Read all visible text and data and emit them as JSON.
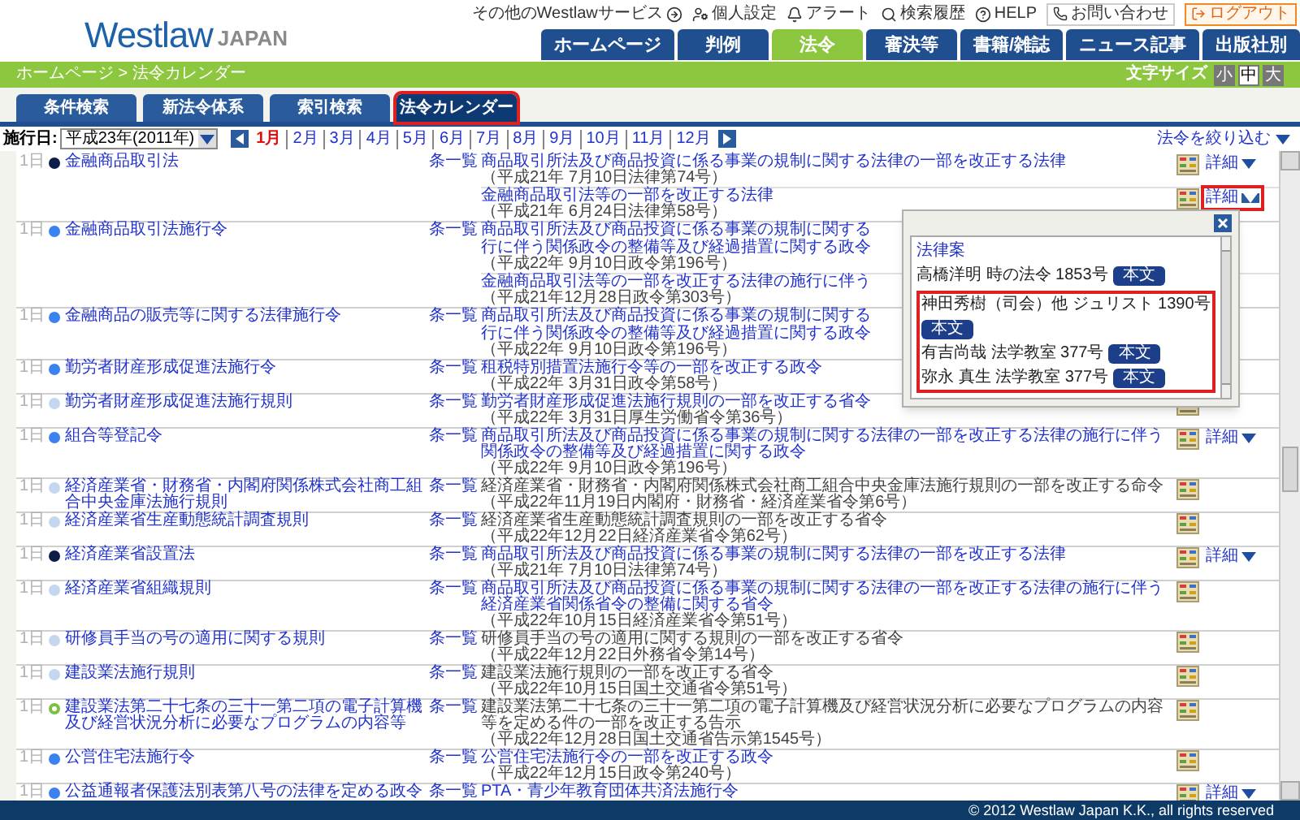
{
  "header": {
    "logo": {
      "word": "Westlaw",
      "suffix": "JAPAN"
    },
    "utility_links": [
      {
        "label": "その他のWestlawサービス",
        "kind": "services"
      },
      {
        "label": "個人設定",
        "kind": "settings"
      },
      {
        "label": "アラート",
        "kind": "alert"
      },
      {
        "label": "検索履歴",
        "kind": "history"
      },
      {
        "label": "HELP",
        "kind": "help"
      }
    ],
    "contact": "お問い合わせ",
    "logout": "ログアウト",
    "tabs": [
      {
        "label": "ホームページ",
        "selected": false
      },
      {
        "label": "判例",
        "selected": false
      },
      {
        "label": "法令",
        "selected": true
      },
      {
        "label": "審決等",
        "selected": false
      },
      {
        "label": "書籍/雑誌",
        "selected": false
      },
      {
        "label": "ニュース記事",
        "selected": false
      },
      {
        "label": "出版社別",
        "selected": false
      }
    ]
  },
  "breadcrumb": "ホームページ > 法令カレンダー",
  "font_size": {
    "label": "文字サイズ",
    "options": [
      {
        "label": "小",
        "selected": false
      },
      {
        "label": "中",
        "selected": true
      },
      {
        "label": "大",
        "selected": false
      }
    ]
  },
  "subtabs": [
    {
      "label": "条件検索",
      "selected": false
    },
    {
      "label": "新法令体系",
      "selected": false
    },
    {
      "label": "索引検索",
      "selected": false
    },
    {
      "label": "法令カレンダー",
      "selected": true
    }
  ],
  "filter_bar": {
    "date_label": "施行日:",
    "year": "平成23年(2011年)",
    "narrow": "法令を絞り込む",
    "months": [
      {
        "label": "1月",
        "selected": true
      },
      {
        "label": "2月",
        "selected": false
      },
      {
        "label": "3月",
        "selected": false
      },
      {
        "label": "4月",
        "selected": false
      },
      {
        "label": "5月",
        "selected": false
      },
      {
        "label": "6月",
        "selected": false
      },
      {
        "label": "7月",
        "selected": false
      },
      {
        "label": "8月",
        "selected": false
      },
      {
        "label": "9月",
        "selected": false
      },
      {
        "label": "10月",
        "selected": false
      },
      {
        "label": "11月",
        "selected": false
      },
      {
        "label": "12月",
        "selected": false
      }
    ]
  },
  "rows": [
    {
      "day": "1日",
      "color": "#0b1d48",
      "kind": "solid",
      "name": "金融商品取引法",
      "articles": "条一覧",
      "amendments": [
        {
          "title": [
            "商品取引所法及び商品投資に係る事業の規制に関する法律の一部を改正する法律"
          ],
          "link": true,
          "citation": "（平成21年 7月10日法律第74号）",
          "icon": true,
          "detail": "詳細",
          "detail_open": false
        },
        {
          "title": [
            "金融商品取引法等の一部を改正する法律"
          ],
          "link": true,
          "citation": "（平成21年 6月24日法律第58号）",
          "icon": true,
          "detail": "詳細",
          "detail_open": true
        }
      ]
    },
    {
      "day": "1日",
      "color": "#3b82f0",
      "kind": "solid",
      "name": "金融商品取引法施行令",
      "articles": "条一覧",
      "amendments": [
        {
          "title": [
            "商品取引所法及び商品投資に係る事業の規制に関する",
            "行に伴う関係政令の整備等及び経過措置に関する政令"
          ],
          "link": true,
          "citation": "（平成22年 9月10日政令第196号）"
        },
        {
          "title": [
            "金融商品取引法等の一部を改正する法律の施行に伴う"
          ],
          "link": true,
          "citation": "（平成21年12月28日政令第303号）"
        }
      ]
    },
    {
      "day": "1日",
      "color": "#3b82f0",
      "kind": "solid",
      "name": "金融商品の販売等に関する法律施行令",
      "articles": "条一覧",
      "amendments": [
        {
          "title": [
            "商品取引所法及び商品投資に係る事業の規制に関する",
            "行に伴う関係政令の整備等及び経過措置に関する政令"
          ],
          "link": true,
          "citation": "（平成22年 9月10日政令第196号）"
        }
      ]
    },
    {
      "day": "1日",
      "color": "#3b82f0",
      "kind": "solid",
      "name": "勤労者財産形成促進法施行令",
      "articles": "条一覧",
      "amendments": [
        {
          "title": [
            "租税特別措置法施行令等の一部を改正する政令"
          ],
          "link": true,
          "citation": "（平成22年 3月31日政令第58号）"
        }
      ]
    },
    {
      "day": "1日",
      "color": "#c5d7ef",
      "kind": "solid",
      "name": "勤労者財産形成促進法施行規則",
      "articles": "条一覧",
      "amendments": [
        {
          "title": [
            "勤労者財産形成促進法施行規則の一部を改正する省令"
          ],
          "link": true,
          "citation": "（平成22年 3月31日厚生労働省令第36号）",
          "icon": true
        }
      ]
    },
    {
      "day": "1日",
      "color": "#3b82f0",
      "kind": "solid",
      "name": "組合等登記令",
      "articles": "条一覧",
      "amendments": [
        {
          "title": [
            "商品取引所法及び商品投資に係る事業の規制に関する法律の一部を改正する法律の施行に伴う関係政令の整備等及び経過措置に関する政令"
          ],
          "link": true,
          "citation": "（平成22年 9月10日政令第196号）",
          "icon": true,
          "detail": "詳細",
          "detail_open": false
        }
      ]
    },
    {
      "day": "1日",
      "color": "#c5d7ef",
      "kind": "solid",
      "name": "経済産業省・財務省・内閣府関係株式会社商工組合中央金庫法施行規則",
      "articles": "条一覧",
      "amendments": [
        {
          "title": [
            "経済産業省・財務省・内閣府関係株式会社商工組合中央金庫法施行規則の一部を改正する命令"
          ],
          "link": false,
          "citation": "（平成22年11月19日内閣府・財務省・経済産業省令第6号）",
          "icon": true
        }
      ]
    },
    {
      "day": "1日",
      "color": "#c5d7ef",
      "kind": "solid",
      "name": "経済産業省生産動態統計調査規則",
      "articles": "条一覧",
      "amendments": [
        {
          "title": [
            "経済産業省生産動態統計調査規則の一部を改正する省令"
          ],
          "link": false,
          "citation": "（平成22年12月22日経済産業省令第62号）",
          "icon": true
        }
      ]
    },
    {
      "day": "1日",
      "color": "#0b1d48",
      "kind": "solid",
      "name": "経済産業省設置法",
      "articles": "条一覧",
      "amendments": [
        {
          "title": [
            "商品取引所法及び商品投資に係る事業の規制に関する法律の一部を改正する法律"
          ],
          "link": true,
          "citation": "（平成21年 7月10日法律第74号）",
          "icon": true,
          "detail": "詳細",
          "detail_open": false
        }
      ]
    },
    {
      "day": "1日",
      "color": "#c5d7ef",
      "kind": "solid",
      "name": "経済産業省組織規則",
      "articles": "条一覧",
      "amendments": [
        {
          "title": [
            "商品取引所法及び商品投資に係る事業の規制に関する法律の一部を改正する法律の施行に伴う経済産業省関係省令の整備に関する省令"
          ],
          "link": true,
          "citation": "（平成22年10月15日経済産業省令第51号）",
          "icon": true
        }
      ]
    },
    {
      "day": "1日",
      "color": "#c5d7ef",
      "kind": "solid",
      "name": "研修員手当の号の適用に関する規則",
      "articles": "条一覧",
      "amendments": [
        {
          "title": [
            "研修員手当の号の適用に関する規則の一部を改正する省令"
          ],
          "link": false,
          "citation": "（平成22年12月22日外務省令第14号）",
          "icon": true
        }
      ]
    },
    {
      "day": "1日",
      "color": "#c5d7ef",
      "kind": "solid",
      "name": "建設業法施行規則",
      "articles": "条一覧",
      "amendments": [
        {
          "title": [
            "建設業法施行規則の一部を改正する省令"
          ],
          "link": false,
          "citation": "（平成22年10月15日国土交通省令第51号）",
          "icon": true
        }
      ]
    },
    {
      "day": "1日",
      "color": "#7cc043",
      "kind": "ring",
      "name": "建設業法第二十七条の三十一第二項の電子計算機及び経営状況分析に必要なプログラムの内容等",
      "articles": "条一覧",
      "amendments": [
        {
          "title": [
            "建設業法第二十七条の三十一第二項の電子計算機及び経営状況分析に必要なプログラムの内容等を定める件の一部を改正する告示"
          ],
          "link": false,
          "citation": "（平成22年12月28日国土交通省告示第1545号）",
          "icon": true
        }
      ]
    },
    {
      "day": "1日",
      "color": "#3b82f0",
      "kind": "solid",
      "name": "公営住宅法施行令",
      "articles": "条一覧",
      "amendments": [
        {
          "title": [
            "公営住宅法施行令の一部を改正する政令"
          ],
          "link": true,
          "citation": "（平成22年12月15日政令第240号）",
          "icon": true
        }
      ]
    },
    {
      "day": "1日",
      "color": "#3b82f0",
      "kind": "solid",
      "name": "公益通報者保護法別表第八号の法律を定める政令",
      "articles": "条一覧",
      "amendments": [
        {
          "title": [
            "PTA・青少年教育団体共済法施行令"
          ],
          "link": true,
          "icon": true,
          "detail": "詳細",
          "detail_open": false
        }
      ]
    }
  ],
  "popup": {
    "heading": "法律案",
    "entries": [
      {
        "text": "高橋洋明 時の法令 1853号",
        "button": "本文",
        "highlighted": false
      },
      {
        "text": "神田秀樹（司会）他 ジュリスト 1390号",
        "button": "本文",
        "highlighted": true
      },
      {
        "text": "有吉尚哉 法学教室 377号",
        "button": "本文",
        "highlighted": true
      },
      {
        "text": "弥永 真生 法学教室 377号",
        "button": "本文",
        "highlighted": true
      }
    ]
  },
  "footer": "© 2012 Westlaw Japan K.K., all rights reserved"
}
